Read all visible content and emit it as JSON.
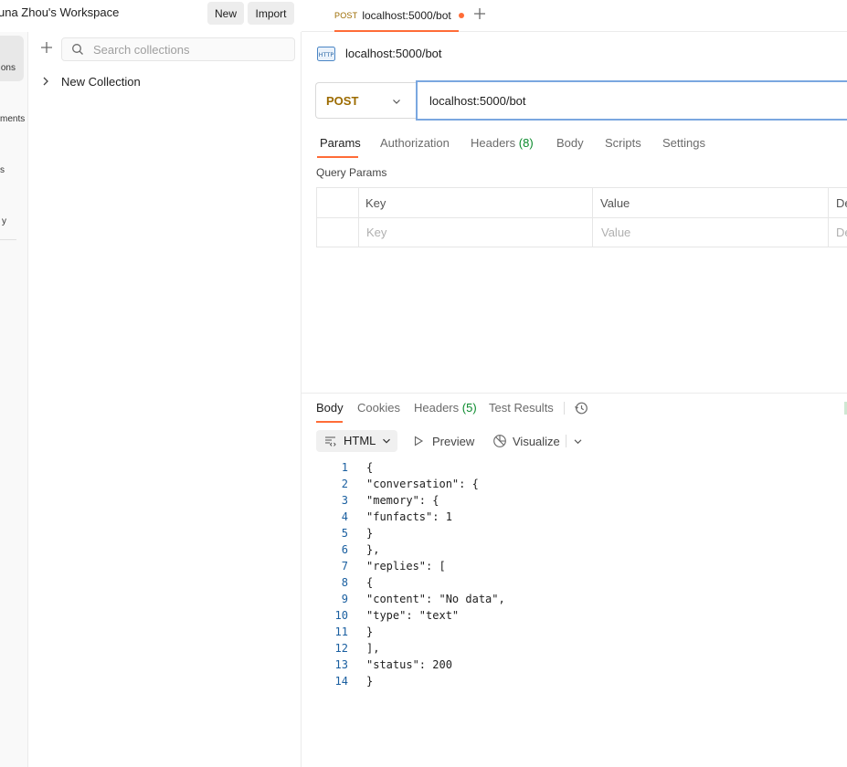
{
  "workspace": {
    "title": "una Zhou's Workspace",
    "new_label": "New",
    "import_label": "Import"
  },
  "rail": {
    "collections": "ons",
    "environments": "ments",
    "flows": "s",
    "history": "y"
  },
  "sidebar": {
    "search_placeholder": "Search collections",
    "collection_name": "New Collection",
    "icons": [
      "plus-icon",
      "search-icon",
      "chevron-right-icon"
    ]
  },
  "tab": {
    "method": "POST",
    "name": "localhost:5000/bot",
    "unsaved": true
  },
  "request": {
    "title": "localhost:5000/bot",
    "method": "POST",
    "url": "localhost:5000/bot",
    "tabs": {
      "params": "Params",
      "authorization": "Authorization",
      "headers": "Headers",
      "headers_count": "(8)",
      "body": "Body",
      "scripts": "Scripts",
      "settings": "Settings"
    },
    "query_params_label": "Query Params",
    "table": {
      "col_key": "Key",
      "col_value": "Value",
      "col_desc": "De",
      "key_placeholder": "Key",
      "value_placeholder": "Value",
      "desc_placeholder": "De"
    }
  },
  "response": {
    "tabs": {
      "body": "Body",
      "cookies": "Cookies",
      "headers": "Headers",
      "headers_count": "(5)",
      "test_results": "Test Results"
    },
    "format": "HTML",
    "preview_label": "Preview",
    "visualize_label": "Visualize",
    "lines": [
      {
        "n": "1",
        "text": "{"
      },
      {
        "n": "2",
        "text": "\"conversation\": {"
      },
      {
        "n": "3",
        "text": "\"memory\": {"
      },
      {
        "n": "4",
        "text": "\"funfacts\": 1"
      },
      {
        "n": "5",
        "text": "}"
      },
      {
        "n": "6",
        "text": "},"
      },
      {
        "n": "7",
        "text": "\"replies\": ["
      },
      {
        "n": "8",
        "text": "{"
      },
      {
        "n": "9",
        "text": "\"content\": \"No data\","
      },
      {
        "n": "10",
        "text": "\"type\": \"text\""
      },
      {
        "n": "11",
        "text": "}"
      },
      {
        "n": "12",
        "text": "],"
      },
      {
        "n": "13",
        "text": "\"status\": 200"
      },
      {
        "n": "14",
        "text": "}"
      }
    ]
  },
  "colors": {
    "accent": "#ff6c37",
    "method_post": "#9c6b00",
    "count_green": "#0a8a2c",
    "url_focus_border": "#7aa7e0"
  }
}
